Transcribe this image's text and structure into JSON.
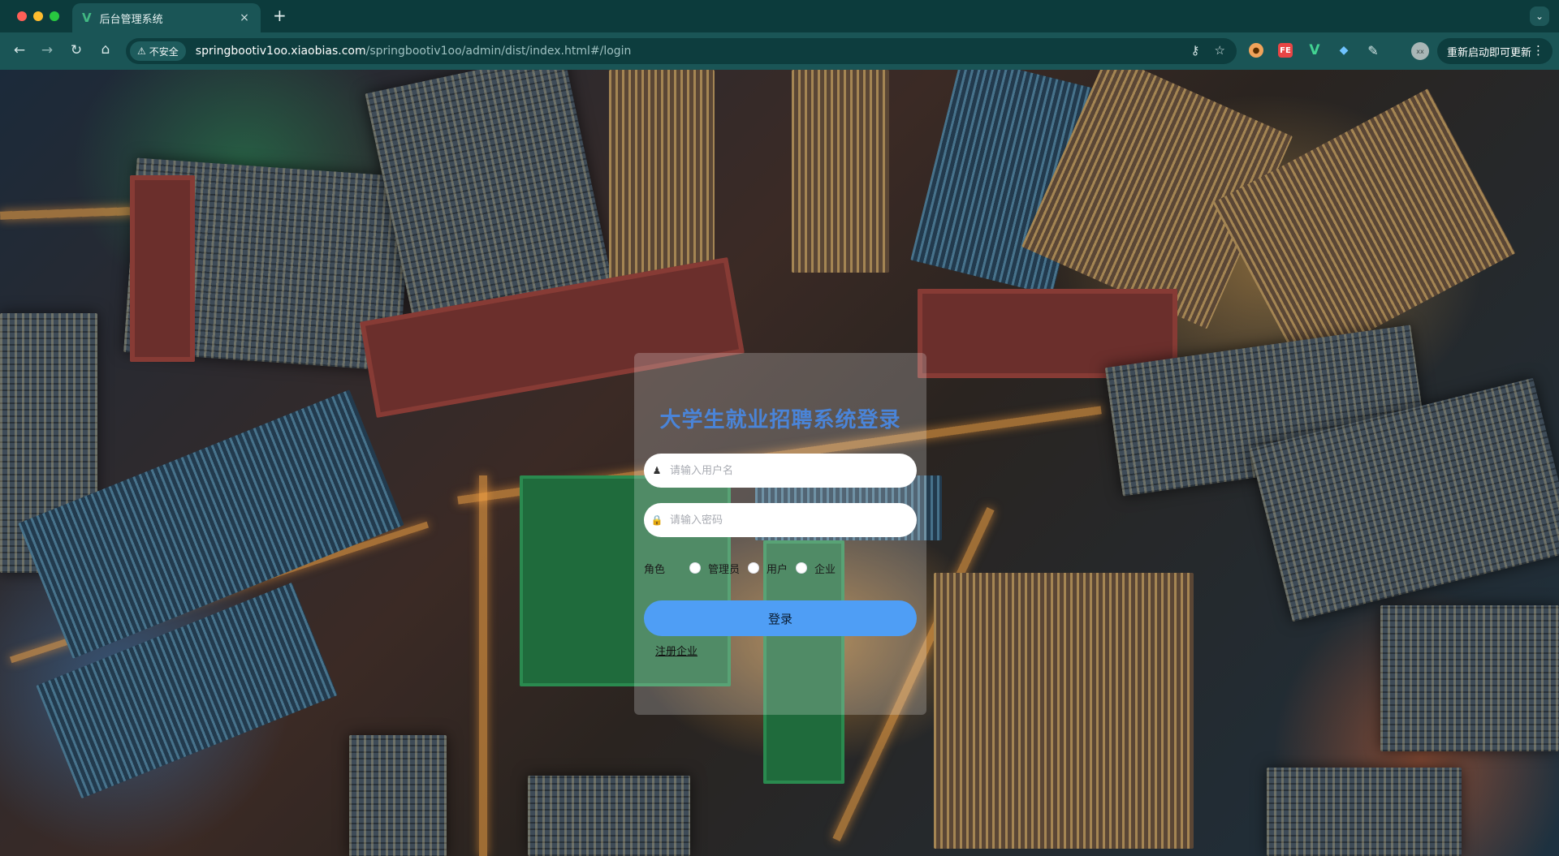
{
  "browser": {
    "tab_title": "后台管理系统",
    "tab_close": "×",
    "new_tab": "+",
    "tab_menu": "⌄",
    "security_label": "不安全",
    "url_host": "springbootiv1oo.xiaobias.com",
    "url_path": "/springbootiv1oo/admin/dist/index.html#/login",
    "avatar_text": "xx",
    "update_label": "重新启动即可更新",
    "more_icon": "⋮",
    "ext_fe": "FE"
  },
  "login": {
    "title": "大学生就业招聘系统登录",
    "username_placeholder": "请输入用户名",
    "password_placeholder": "请输入密码",
    "role_label": "角色",
    "roles": [
      {
        "label": "管理员"
      },
      {
        "label": "用户"
      },
      {
        "label": "企业"
      }
    ],
    "login_button": "登录",
    "register_link": "注册企业"
  }
}
